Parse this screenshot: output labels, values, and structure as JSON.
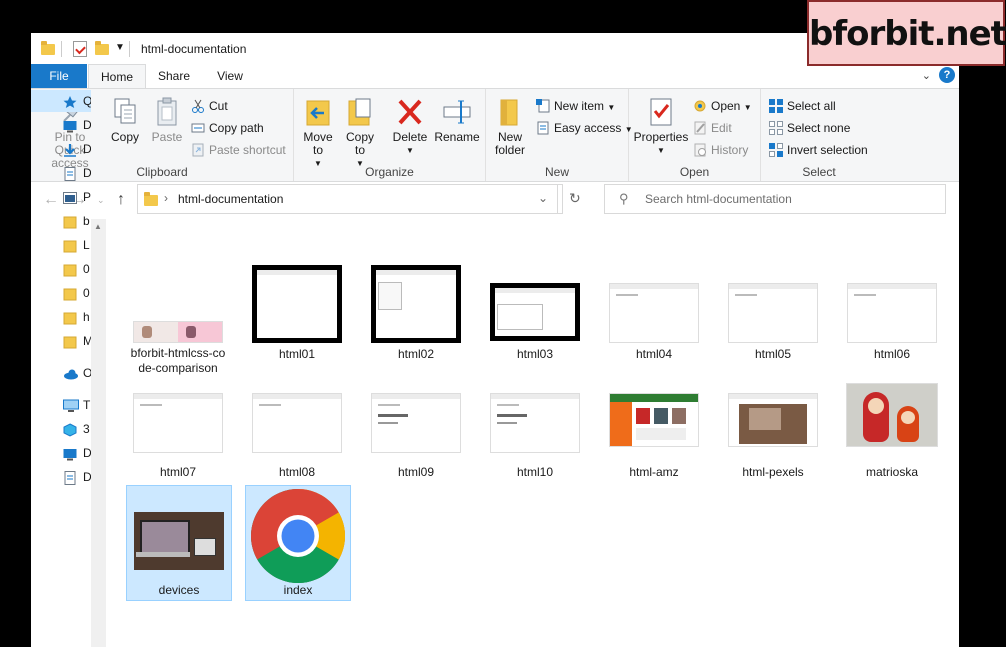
{
  "window": {
    "title": "html-documentation"
  },
  "tabs": [
    {
      "label": "File"
    },
    {
      "label": "Home"
    },
    {
      "label": "Share"
    },
    {
      "label": "View"
    }
  ],
  "ribbon": {
    "clipboard": {
      "group_label": "Clipboard",
      "pin": "Pin to Quick access",
      "copy": "Copy",
      "paste": "Paste",
      "cut": "Cut",
      "copy_path": "Copy path",
      "paste_shortcut": "Paste shortcut"
    },
    "organize": {
      "group_label": "Organize",
      "move_to": "Move to",
      "copy_to": "Copy to",
      "delete": "Delete",
      "rename": "Rename"
    },
    "new": {
      "group_label": "New",
      "new_folder": "New folder",
      "new_item": "New item",
      "easy_access": "Easy access"
    },
    "open": {
      "group_label": "Open",
      "properties": "Properties",
      "open": "Open",
      "edit": "Edit",
      "history": "History"
    },
    "select": {
      "group_label": "Select",
      "select_all": "Select all",
      "select_none": "Select none",
      "invert_selection": "Invert selection"
    }
  },
  "address": {
    "path": "html-documentation",
    "search_placeholder": "Search html-documentation"
  },
  "nav": {
    "items": [
      {
        "label": "Qu",
        "icon": "star-icon"
      },
      {
        "label": "D",
        "icon": "desktop-icon"
      },
      {
        "label": "D",
        "icon": "download-icon"
      },
      {
        "label": "D",
        "icon": "document-icon"
      },
      {
        "label": "P",
        "icon": "pictures-icon"
      },
      {
        "label": "b",
        "icon": "folder-icon"
      },
      {
        "label": "L",
        "icon": "folder-icon"
      },
      {
        "label": "0",
        "icon": "folder-icon"
      },
      {
        "label": "0",
        "icon": "folder-icon"
      },
      {
        "label": "h",
        "icon": "folder-icon"
      },
      {
        "label": "M",
        "icon": "folder-icon"
      },
      {
        "label": "Or",
        "icon": "cloud-icon"
      },
      {
        "label": "Th",
        "icon": "computer-icon"
      },
      {
        "label": "3",
        "icon": "cube-icon"
      },
      {
        "label": "D",
        "icon": "desktop-icon"
      },
      {
        "label": "D",
        "icon": "document-icon"
      }
    ]
  },
  "files": [
    {
      "name": "bforbit-htmlcss-code-comparison"
    },
    {
      "name": "html01"
    },
    {
      "name": "html02"
    },
    {
      "name": "html03"
    },
    {
      "name": "html04"
    },
    {
      "name": "html05"
    },
    {
      "name": "html06"
    },
    {
      "name": "html07"
    },
    {
      "name": "html08"
    },
    {
      "name": "html09"
    },
    {
      "name": "html10"
    },
    {
      "name": "html-amz"
    },
    {
      "name": "html-pexels"
    },
    {
      "name": "matrioska"
    },
    {
      "name": "devices"
    },
    {
      "name": "index"
    }
  ],
  "watermark": {
    "text": "bforbit.net"
  },
  "colors": {
    "accent": "#1979ca",
    "selection": "#cce8ff",
    "folder": "#f3c84b",
    "delete_red": "#d9281e"
  }
}
